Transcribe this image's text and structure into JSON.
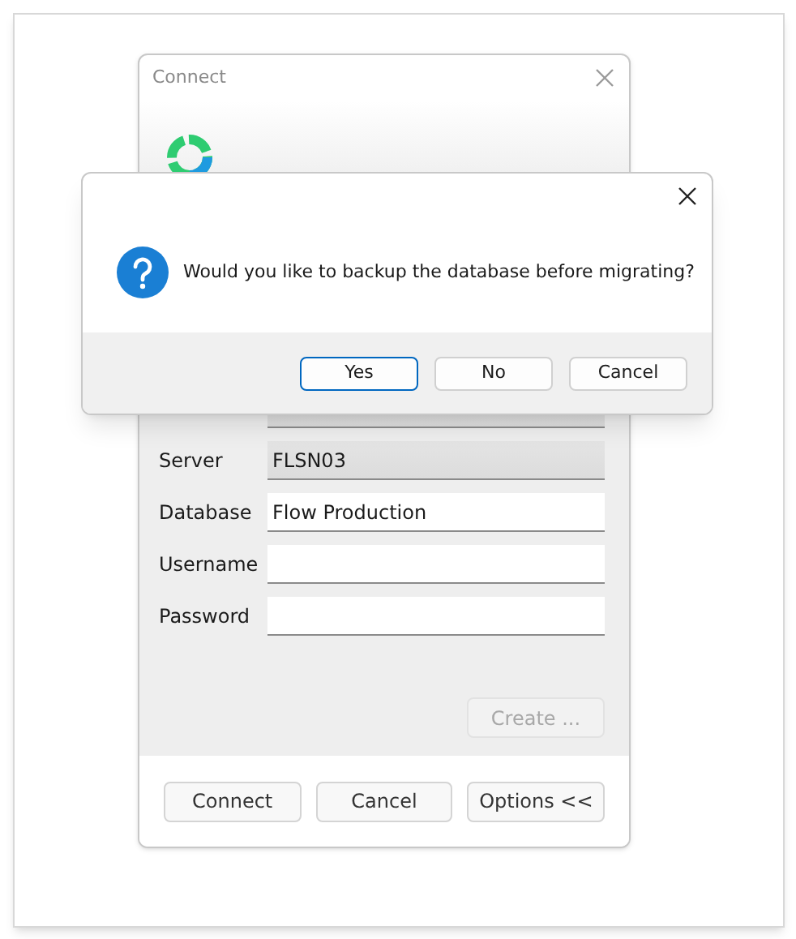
{
  "connect_window": {
    "title": "Connect",
    "fields": [
      {
        "readonly": true
      },
      {
        "label": "Server",
        "value": "FLSN03",
        "readonly": true
      },
      {
        "label": "Database",
        "value": "Flow Production",
        "readonly": false
      },
      {
        "label": "Username",
        "readonly": false
      },
      {
        "label": "Password",
        "readonly": false
      }
    ],
    "create_button": {
      "label": "Create ...",
      "disabled": true
    },
    "buttons": [
      "Connect",
      "Cancel",
      "Options <<"
    ]
  },
  "message_box": {
    "message": "Would you like to backup the database before migrating?",
    "buttons": [
      {
        "label": "Yes",
        "selected": true
      },
      {
        "label": "No",
        "selected": false
      },
      {
        "label": "Cancel",
        "selected": false
      }
    ]
  }
}
